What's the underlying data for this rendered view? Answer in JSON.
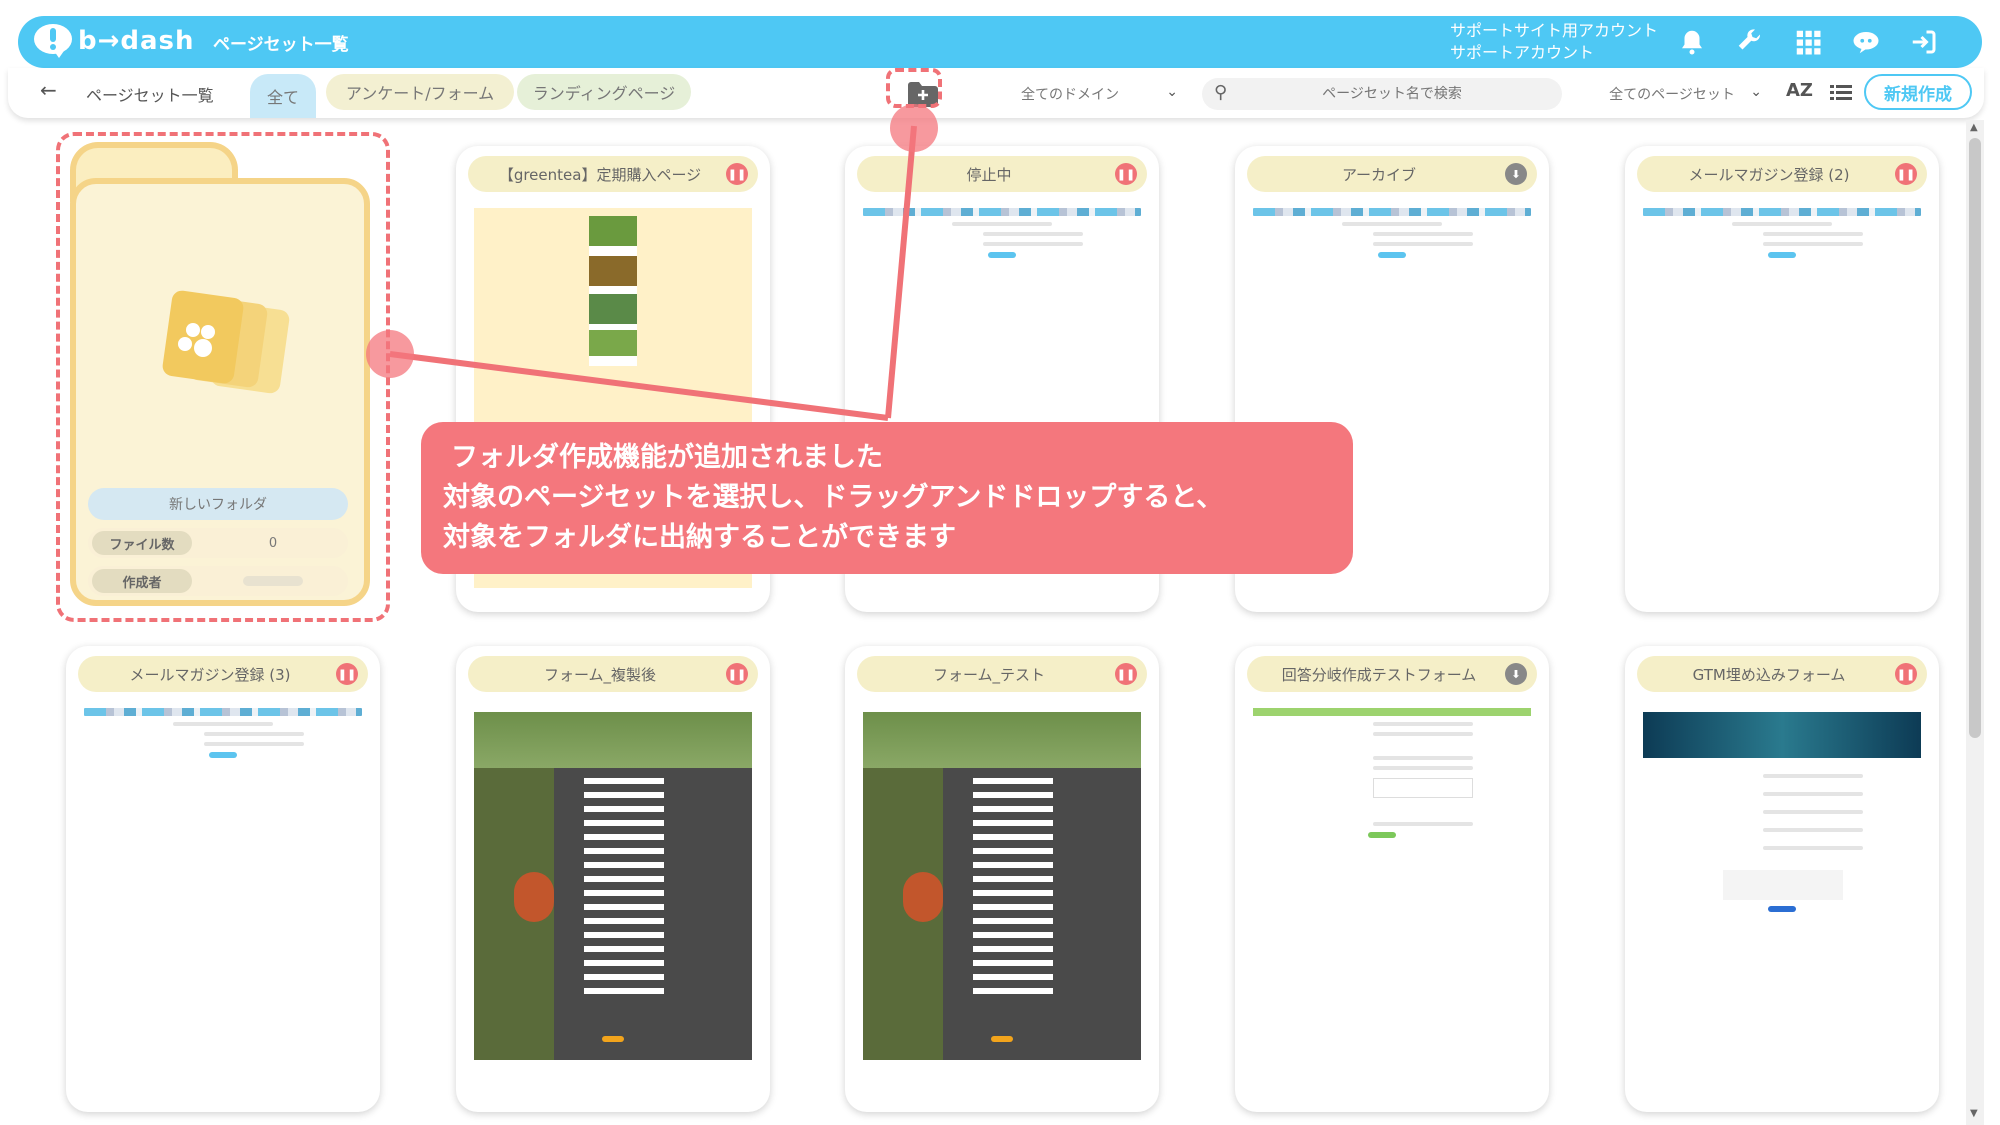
{
  "header": {
    "logo_text": "b→dash",
    "page_title": "ページセット一覧",
    "account_line1": "サポートサイト用アカウント",
    "account_line2": "サポートアカウント",
    "icons": [
      "bell-icon",
      "wrench-icon",
      "apps-grid-icon",
      "support-chat-icon",
      "logout-icon"
    ],
    "accent_color": "#4ec8f4"
  },
  "toolbar": {
    "back_glyph": "←",
    "breadcrumb": "ページセット一覧",
    "tabs": [
      {
        "label": "全て",
        "active": true
      },
      {
        "label": "アンケート/フォーム",
        "active": false
      },
      {
        "label": "ランディングページ",
        "active": false
      }
    ],
    "domain_select": "全てのドメイン",
    "search_placeholder": "ページセット名で検索",
    "pageset_select": "全てのページセット",
    "sort_label": "AZ",
    "new_button": "新規作成"
  },
  "folder_card": {
    "name": "新しいフォルダ",
    "file_count_label": "ファイル数",
    "file_count_value": "0",
    "creator_label": "作成者"
  },
  "cards": [
    {
      "title": "【greentea】定期購入ページ",
      "status": "paused"
    },
    {
      "title": "停止中",
      "status": "paused"
    },
    {
      "title": "アーカイブ",
      "status": "archived"
    },
    {
      "title": "メールマガジン登録 (2)",
      "status": "paused"
    },
    {
      "title": "メールマガジン登録 (3)",
      "status": "paused"
    },
    {
      "title": "フォーム_複製後",
      "status": "paused"
    },
    {
      "title": "フォーム_テスト",
      "status": "paused"
    },
    {
      "title": "回答分岐作成テストフォーム",
      "status": "archived"
    },
    {
      "title": "GTM埋め込みフォーム",
      "status": "paused"
    }
  ],
  "annotation": {
    "line1": "フォルダ作成機能が追加されました",
    "line2": "対象のページセットを選択し、ドラッグアンドドロップすると、",
    "line3": "対象をフォルダに出納することができます",
    "color": "#f4777d"
  }
}
